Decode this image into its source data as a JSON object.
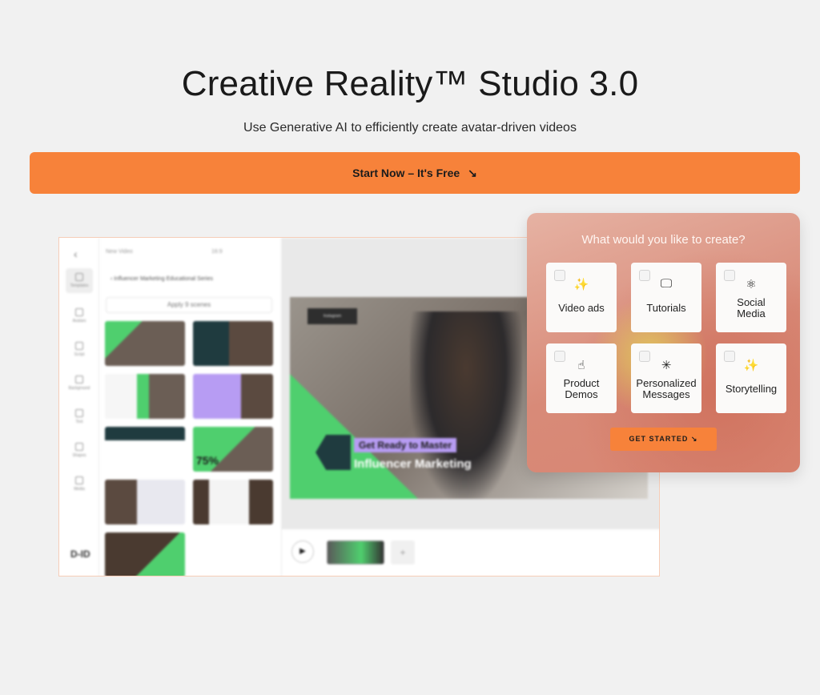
{
  "hero": {
    "title": "Creative Reality™ Studio 3.0",
    "subtitle": "Use Generative AI to efficiently create avatar-driven videos",
    "cta_label": "Start Now – It's Free",
    "cta_arrow": "↘"
  },
  "editor": {
    "back": "‹",
    "title": "New Video",
    "ratio": "16:9",
    "rail": [
      "Templates",
      "Avatars",
      "Script",
      "Background",
      "Text",
      "Shapes",
      "Media"
    ],
    "logo": "D-ID",
    "crumb": "‹  Influencer Marketing Educational Series",
    "apply": "Apply 9 scenes",
    "stage": {
      "badge": "Instagram",
      "headline_small": "Get Ready to Master",
      "headline_large": "Influencer Marketing"
    },
    "timeline": {
      "play": "▶",
      "add": "+"
    },
    "thumb_label": "75%"
  },
  "card": {
    "question": "What would you like to create?",
    "options": [
      {
        "icon": "✨",
        "label": "Video ads"
      },
      {
        "icon": "🖵",
        "label": "Tutorials"
      },
      {
        "icon": "⚛",
        "label": "Social\nMedia"
      },
      {
        "icon": "☝",
        "label": "Product\nDemos"
      },
      {
        "icon": "✳",
        "label": "Personalized\nMessages"
      },
      {
        "icon": "✨",
        "label": "Storytelling"
      }
    ],
    "button_label": "GET STARTED",
    "button_arrow": "↘"
  },
  "colors": {
    "accent": "#f7823a",
    "background": "#f1f1f1",
    "green": "#4fcf6e",
    "purple": "#b79cf3"
  }
}
